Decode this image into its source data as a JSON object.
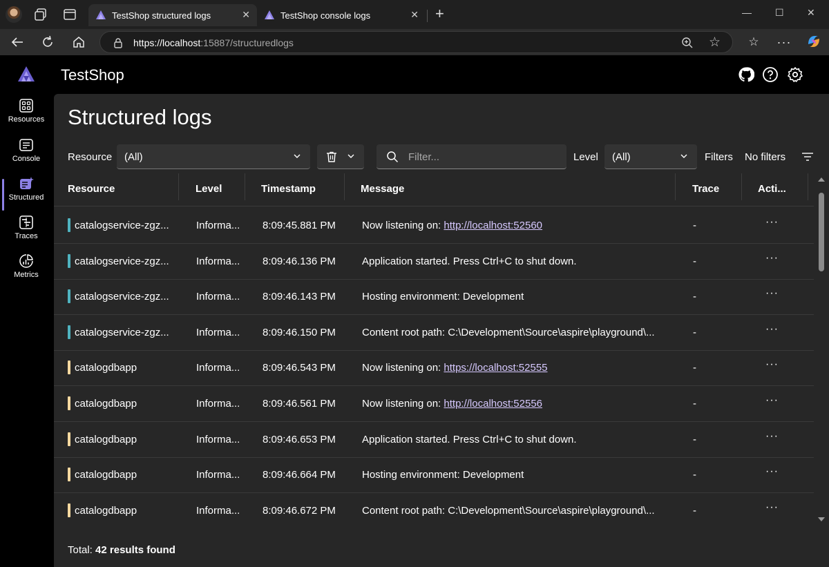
{
  "browser": {
    "tabs": [
      {
        "label": "TestShop structured logs",
        "active": true
      },
      {
        "label": "TestShop console logs",
        "active": false
      }
    ],
    "url_host": "https://localhost",
    "url_rest": ":15887/structuredlogs"
  },
  "app": {
    "title": "TestShop",
    "nav": [
      {
        "label": "Resources",
        "icon": "resources-icon"
      },
      {
        "label": "Console",
        "icon": "console-icon"
      },
      {
        "label": "Structured",
        "icon": "structured-icon",
        "active": true
      },
      {
        "label": "Traces",
        "icon": "traces-icon"
      },
      {
        "label": "Metrics",
        "icon": "metrics-icon"
      }
    ]
  },
  "page": {
    "title": "Structured logs",
    "toolbar": {
      "resource_label": "Resource",
      "resource_value": "(All)",
      "filter_placeholder": "Filter...",
      "level_label": "Level",
      "level_value": "(All)",
      "filters_label": "Filters",
      "filters_value": "No filters"
    },
    "columns": [
      "Resource",
      "Level",
      "Timestamp",
      "Message",
      "Trace",
      "Acti..."
    ],
    "rows": [
      {
        "resource": "catalogservice-zgz...",
        "level": "Informa...",
        "timestamp": "8:09:45.881 PM",
        "message_prefix": "Now listening on: ",
        "message_link": "http://localhost:52560",
        "trace": "-",
        "color": "#4fb3bf"
      },
      {
        "resource": "catalogservice-zgz...",
        "level": "Informa...",
        "timestamp": "8:09:46.136 PM",
        "message_prefix": "Application started. Press Ctrl+C to shut down.",
        "message_link": "",
        "trace": "-",
        "color": "#4fb3bf"
      },
      {
        "resource": "catalogservice-zgz...",
        "level": "Informa...",
        "timestamp": "8:09:46.143 PM",
        "message_prefix": "Hosting environment: Development",
        "message_link": "",
        "trace": "-",
        "color": "#4fb3bf"
      },
      {
        "resource": "catalogservice-zgz...",
        "level": "Informa...",
        "timestamp": "8:09:46.150 PM",
        "message_prefix": "Content root path: C:\\Development\\Source\\aspire\\playground\\...",
        "message_link": "",
        "trace": "-",
        "color": "#4fb3bf"
      },
      {
        "resource": "catalogdbapp",
        "level": "Informa...",
        "timestamp": "8:09:46.543 PM",
        "message_prefix": "Now listening on: ",
        "message_link": "https://localhost:52555",
        "trace": "-",
        "color": "#f6d9a0"
      },
      {
        "resource": "catalogdbapp",
        "level": "Informa...",
        "timestamp": "8:09:46.561 PM",
        "message_prefix": "Now listening on: ",
        "message_link": "http://localhost:52556",
        "trace": "-",
        "color": "#f6d9a0"
      },
      {
        "resource": "catalogdbapp",
        "level": "Informa...",
        "timestamp": "8:09:46.653 PM",
        "message_prefix": "Application started. Press Ctrl+C to shut down.",
        "message_link": "",
        "trace": "-",
        "color": "#f6d9a0"
      },
      {
        "resource": "catalogdbapp",
        "level": "Informa...",
        "timestamp": "8:09:46.664 PM",
        "message_prefix": "Hosting environment: Development",
        "message_link": "",
        "trace": "-",
        "color": "#f6d9a0"
      },
      {
        "resource": "catalogdbapp",
        "level": "Informa...",
        "timestamp": "8:09:46.672 PM",
        "message_prefix": "Content root path: C:\\Development\\Source\\aspire\\playground\\...",
        "message_link": "",
        "trace": "-",
        "color": "#f6d9a0"
      }
    ],
    "row_action": "···",
    "footer_label": "Total:",
    "footer_count": "42 results found"
  }
}
